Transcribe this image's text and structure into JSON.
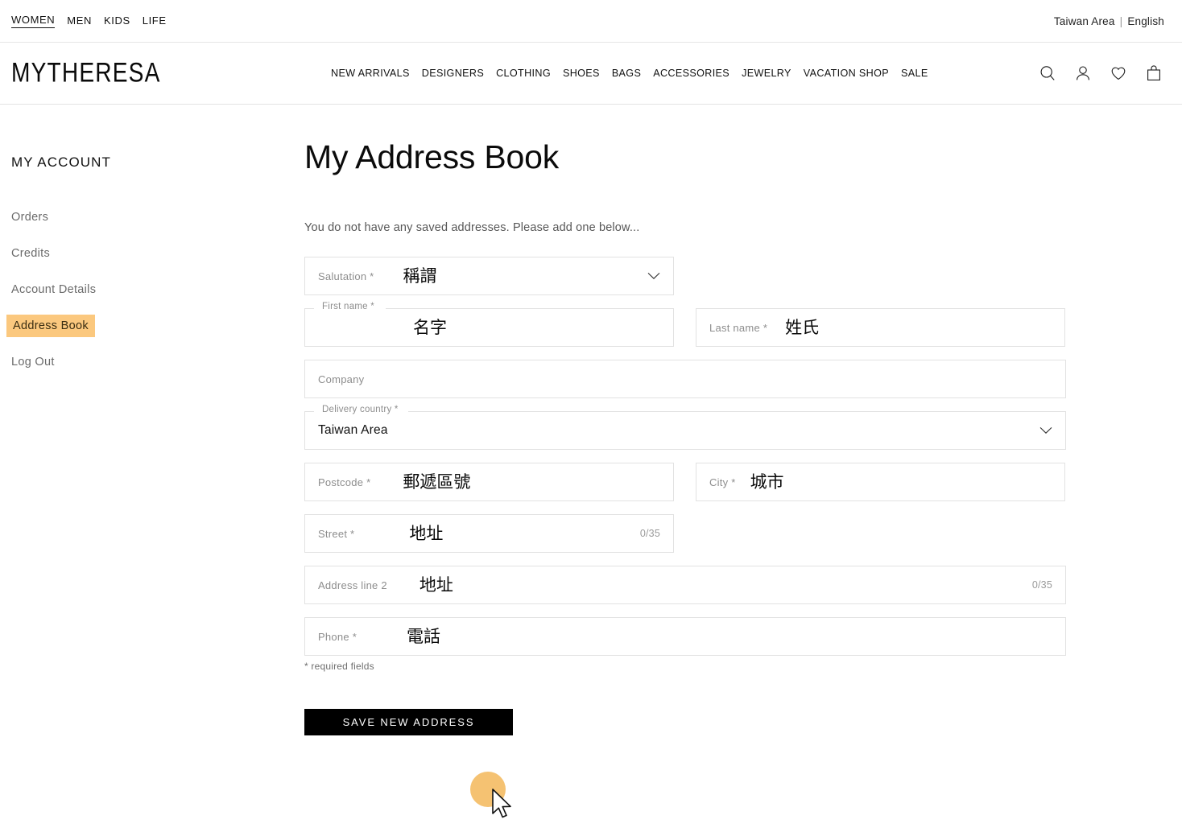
{
  "topbar": {
    "links": [
      {
        "label": "WOMEN",
        "active": true
      },
      {
        "label": "MEN",
        "active": false
      },
      {
        "label": "KIDS",
        "active": false
      },
      {
        "label": "LIFE",
        "active": false
      }
    ],
    "region": "Taiwan Area",
    "separator": "|",
    "language": "English"
  },
  "header": {
    "logo": "MYTHERESA",
    "nav": [
      {
        "label": "NEW ARRIVALS"
      },
      {
        "label": "DESIGNERS"
      },
      {
        "label": "CLOTHING"
      },
      {
        "label": "SHOES"
      },
      {
        "label": "BAGS"
      },
      {
        "label": "ACCESSORIES"
      },
      {
        "label": "JEWELRY"
      },
      {
        "label": "VACATION SHOP"
      },
      {
        "label": "SALE"
      }
    ],
    "icons": [
      {
        "name": "search-icon"
      },
      {
        "name": "account-icon"
      },
      {
        "name": "wishlist-heart-icon"
      },
      {
        "name": "shopping-bag-icon"
      }
    ]
  },
  "sidebar": {
    "title": "MY ACCOUNT",
    "items": [
      {
        "label": "Orders",
        "active": false
      },
      {
        "label": "Credits",
        "active": false
      },
      {
        "label": "Account Details",
        "active": false
      },
      {
        "label": "Address Book",
        "active": true
      },
      {
        "label": "Log Out",
        "active": false
      }
    ],
    "active_highlight_color": "#fbc87e"
  },
  "main": {
    "title": "My Address Book",
    "intro": "You do not have any saved addresses. Please add one below...",
    "required_note": "* required fields",
    "save_button": "SAVE NEW ADDRESS",
    "fields": {
      "salutation": {
        "label": "Salutation *",
        "value": "稱謂",
        "icon": "chevron-down-icon"
      },
      "first_name": {
        "label": "First name *",
        "value": "名字"
      },
      "last_name": {
        "label": "Last name *",
        "value": "姓氏"
      },
      "company": {
        "label": "Company",
        "value": ""
      },
      "delivery_country": {
        "label": "Delivery country *",
        "value": "Taiwan Area",
        "icon": "chevron-down-icon"
      },
      "postcode": {
        "label": "Postcode *",
        "value": "郵遞區號"
      },
      "city": {
        "label": "City *",
        "value": "城市"
      },
      "street": {
        "label": "Street *",
        "value": "地址",
        "counter": "0/35"
      },
      "address_line_2": {
        "label": "Address line 2",
        "value": "地址",
        "counter": "0/35"
      },
      "phone": {
        "label": "Phone *",
        "value": "電話"
      }
    }
  },
  "pointer": {
    "click_highlight_color": "#f4ba5e",
    "cursor": "arrow-cursor"
  }
}
